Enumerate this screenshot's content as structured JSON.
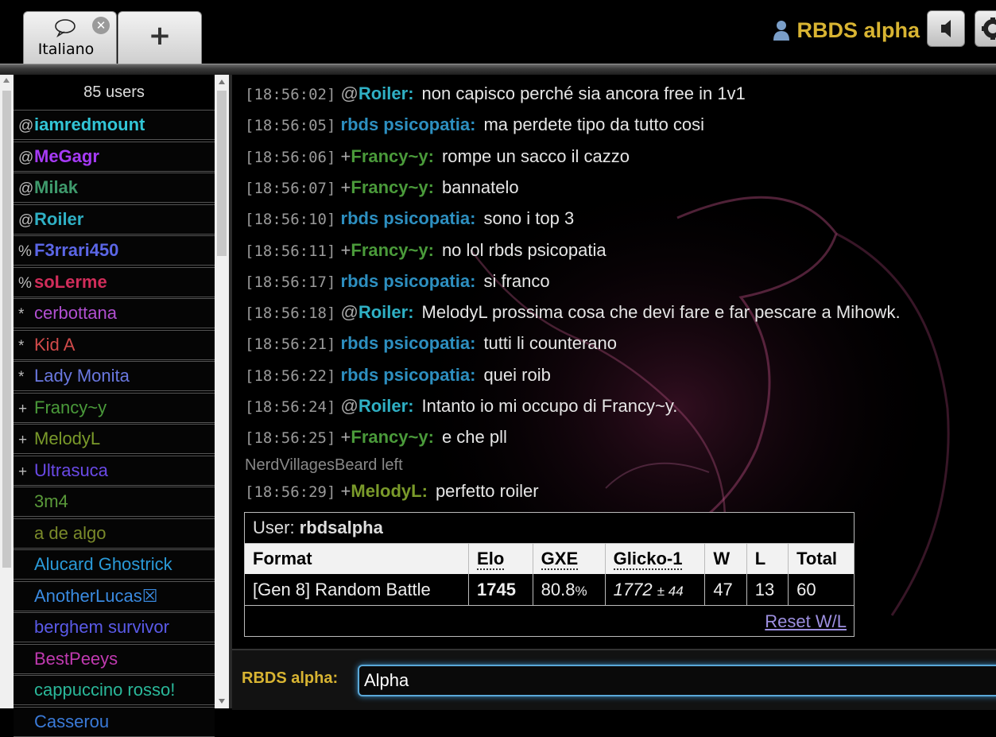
{
  "tabs": [
    {
      "label": "Italiano",
      "icon": "chat-bubble-icon"
    },
    {
      "label": "+",
      "icon": "plus-icon"
    }
  ],
  "header": {
    "user_name": "RBDS alpha"
  },
  "userlist": {
    "count_label": "85 users",
    "users": [
      {
        "sym": "@",
        "name": "iamredmount",
        "color": "#32c5d6",
        "bold": true
      },
      {
        "sym": "@",
        "name": "MeGagr",
        "color": "#a63af7",
        "bold": true
      },
      {
        "sym": "@",
        "name": "Milak",
        "color": "#3f9a6c",
        "bold": true
      },
      {
        "sym": "@",
        "name": "Roiler",
        "color": "#2fb0c4",
        "bold": true
      },
      {
        "sym": "%",
        "name": "F3rrari450",
        "color": "#5b66e6",
        "bold": true
      },
      {
        "sym": "%",
        "name": "soLerme",
        "color": "#d02d5a",
        "bold": true
      },
      {
        "sym": "*",
        "name": "cerbottana",
        "color": "#b04fd0",
        "bold": false
      },
      {
        "sym": "*",
        "name": "Kid A",
        "color": "#d04a4a",
        "bold": false
      },
      {
        "sym": "*",
        "name": "Lady Monita",
        "color": "#6a78e0",
        "bold": false
      },
      {
        "sym": "+",
        "name": "Francy~y",
        "color": "#4a9a3a",
        "bold": false
      },
      {
        "sym": "+",
        "name": "MelodyL",
        "color": "#7a9a2a",
        "bold": false
      },
      {
        "sym": "+",
        "name": "Ultrasuca",
        "color": "#6a4ae8",
        "bold": false
      },
      {
        "sym": "",
        "name": "3m4",
        "color": "#5a9a3a",
        "bold": false
      },
      {
        "sym": "",
        "name": "a de algo",
        "color": "#7a8a2a",
        "bold": false
      },
      {
        "sym": "",
        "name": "Alucard Ghostrick",
        "color": "#2a9ad8",
        "bold": false
      },
      {
        "sym": "",
        "name": "AnotherLucas☒",
        "color": "#3a8ae0",
        "bold": false
      },
      {
        "sym": "",
        "name": "berghem survivor",
        "color": "#5a5ae8",
        "bold": false
      },
      {
        "sym": "",
        "name": "BestPeeys",
        "color": "#c03ab0",
        "bold": false
      },
      {
        "sym": "",
        "name": "cappuccino rosso!",
        "color": "#2ab89a",
        "bold": false
      },
      {
        "sym": "",
        "name": "Casserou",
        "color": "#3a7ad8",
        "bold": false
      }
    ]
  },
  "chat": {
    "messages": [
      {
        "time": "[18:56:02]",
        "rank": "@",
        "user": "Roiler:",
        "color": "#2fb0c4",
        "text": "non capisco perché sia ancora free in 1v1"
      },
      {
        "time": "[18:56:05]",
        "rank": "",
        "user": "rbds psicopatia:",
        "color": "#2d8fc0",
        "text": "ma perdete tipo da tutto cosi"
      },
      {
        "time": "[18:56:06]",
        "rank": "+",
        "user": "Francy~y:",
        "color": "#4a9a3a",
        "text": "rompe un sacco il cazzo"
      },
      {
        "time": "[18:56:07]",
        "rank": "+",
        "user": "Francy~y:",
        "color": "#4a9a3a",
        "text": "bannatelo"
      },
      {
        "time": "[18:56:10]",
        "rank": "",
        "user": "rbds psicopatia:",
        "color": "#2d8fc0",
        "text": "sono i top 3"
      },
      {
        "time": "[18:56:11]",
        "rank": "+",
        "user": "Francy~y:",
        "color": "#4a9a3a",
        "text": "no lol rbds psicopatia"
      },
      {
        "time": "[18:56:17]",
        "rank": "",
        "user": "rbds psicopatia:",
        "color": "#2d8fc0",
        "text": "si franco"
      },
      {
        "time": "[18:56:18]",
        "rank": "@",
        "user": "Roiler:",
        "color": "#2fb0c4",
        "text": "MelodyL prossima cosa che devi fare e far pescare a Mihowk."
      },
      {
        "time": "[18:56:21]",
        "rank": "",
        "user": "rbds psicopatia:",
        "color": "#2d8fc0",
        "text": "tutti li counterano"
      },
      {
        "time": "[18:56:22]",
        "rank": "",
        "user": "rbds psicopatia:",
        "color": "#2d8fc0",
        "text": "quei roib"
      },
      {
        "time": "[18:56:24]",
        "rank": "@",
        "user": "Roiler:",
        "color": "#2fb0c4",
        "text": "Intanto io mi occupo di Francy~y."
      },
      {
        "time": "[18:56:25]",
        "rank": "+",
        "user": "Francy~y:",
        "color": "#4a9a3a",
        "text": "e che pll"
      }
    ],
    "notice": "NerdVillagesBeard left",
    "last_message": {
      "time": "[18:56:29]",
      "rank": "+",
      "user": "MelodyL:",
      "color": "#7a9a2a",
      "text": "perfetto roiler"
    }
  },
  "stats": {
    "user_label": "User:",
    "user_value": "rbdsalpha",
    "columns": [
      "Format",
      "Elo",
      "GXE",
      "Glicko-1",
      "W",
      "L",
      "Total"
    ],
    "row": {
      "format": "[Gen 8] Random Battle",
      "elo": "1745",
      "gxe_main": "80.8",
      "gxe_unit": "%",
      "glicko_main": "1772",
      "glicko_dev": "± 44",
      "w": "47",
      "l": "13",
      "total": "60"
    },
    "reset_label": "Reset W/L"
  },
  "compose": {
    "label": "RBDS alpha:",
    "value": "Alpha"
  },
  "colors": {
    "gold": "#d8b432",
    "input_border": "#5aa8d8"
  }
}
